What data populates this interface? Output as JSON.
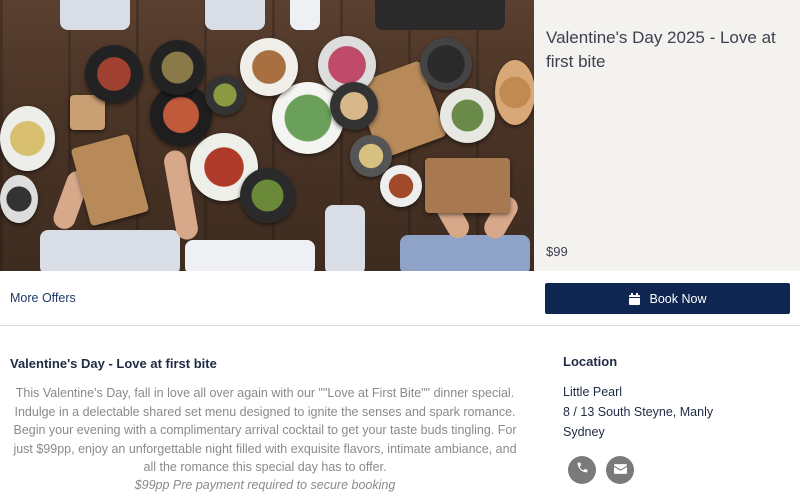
{
  "offer": {
    "title": "Valentine's Day 2025 - Love at first bite",
    "price": "$99"
  },
  "actions": {
    "more_offers_label": "More Offers",
    "book_label": "Book Now",
    "book_icon": "calendar-icon"
  },
  "description": {
    "title": "Valentine's Day - Love at first bite",
    "body": "This Valentine's Day, fall in love all over again with our \"\"Love at First Bite\"\" dinner special. Indulge in a delectable shared set menu designed to ignite the senses and spark romance. Begin your evening with a complimentary arrival cocktail to get your taste buds tingling. For just $99pp,  enjoy an unforgettable night filled with exquisite flavors, intimate ambiance, and all the romance this special day has to offer.",
    "note": "$99pp Pre payment required to secure booking"
  },
  "location": {
    "heading": "Location",
    "venue": "Little Pearl",
    "address": "8 / 13 South Steyne, Manly",
    "city": "Sydney",
    "contact_icons": [
      "phone-icon",
      "envelope-icon"
    ]
  },
  "colors": {
    "primary_button": "#0f2552",
    "panel_background": "#f3f2ee",
    "icon_circle": "#7a7a7a"
  }
}
